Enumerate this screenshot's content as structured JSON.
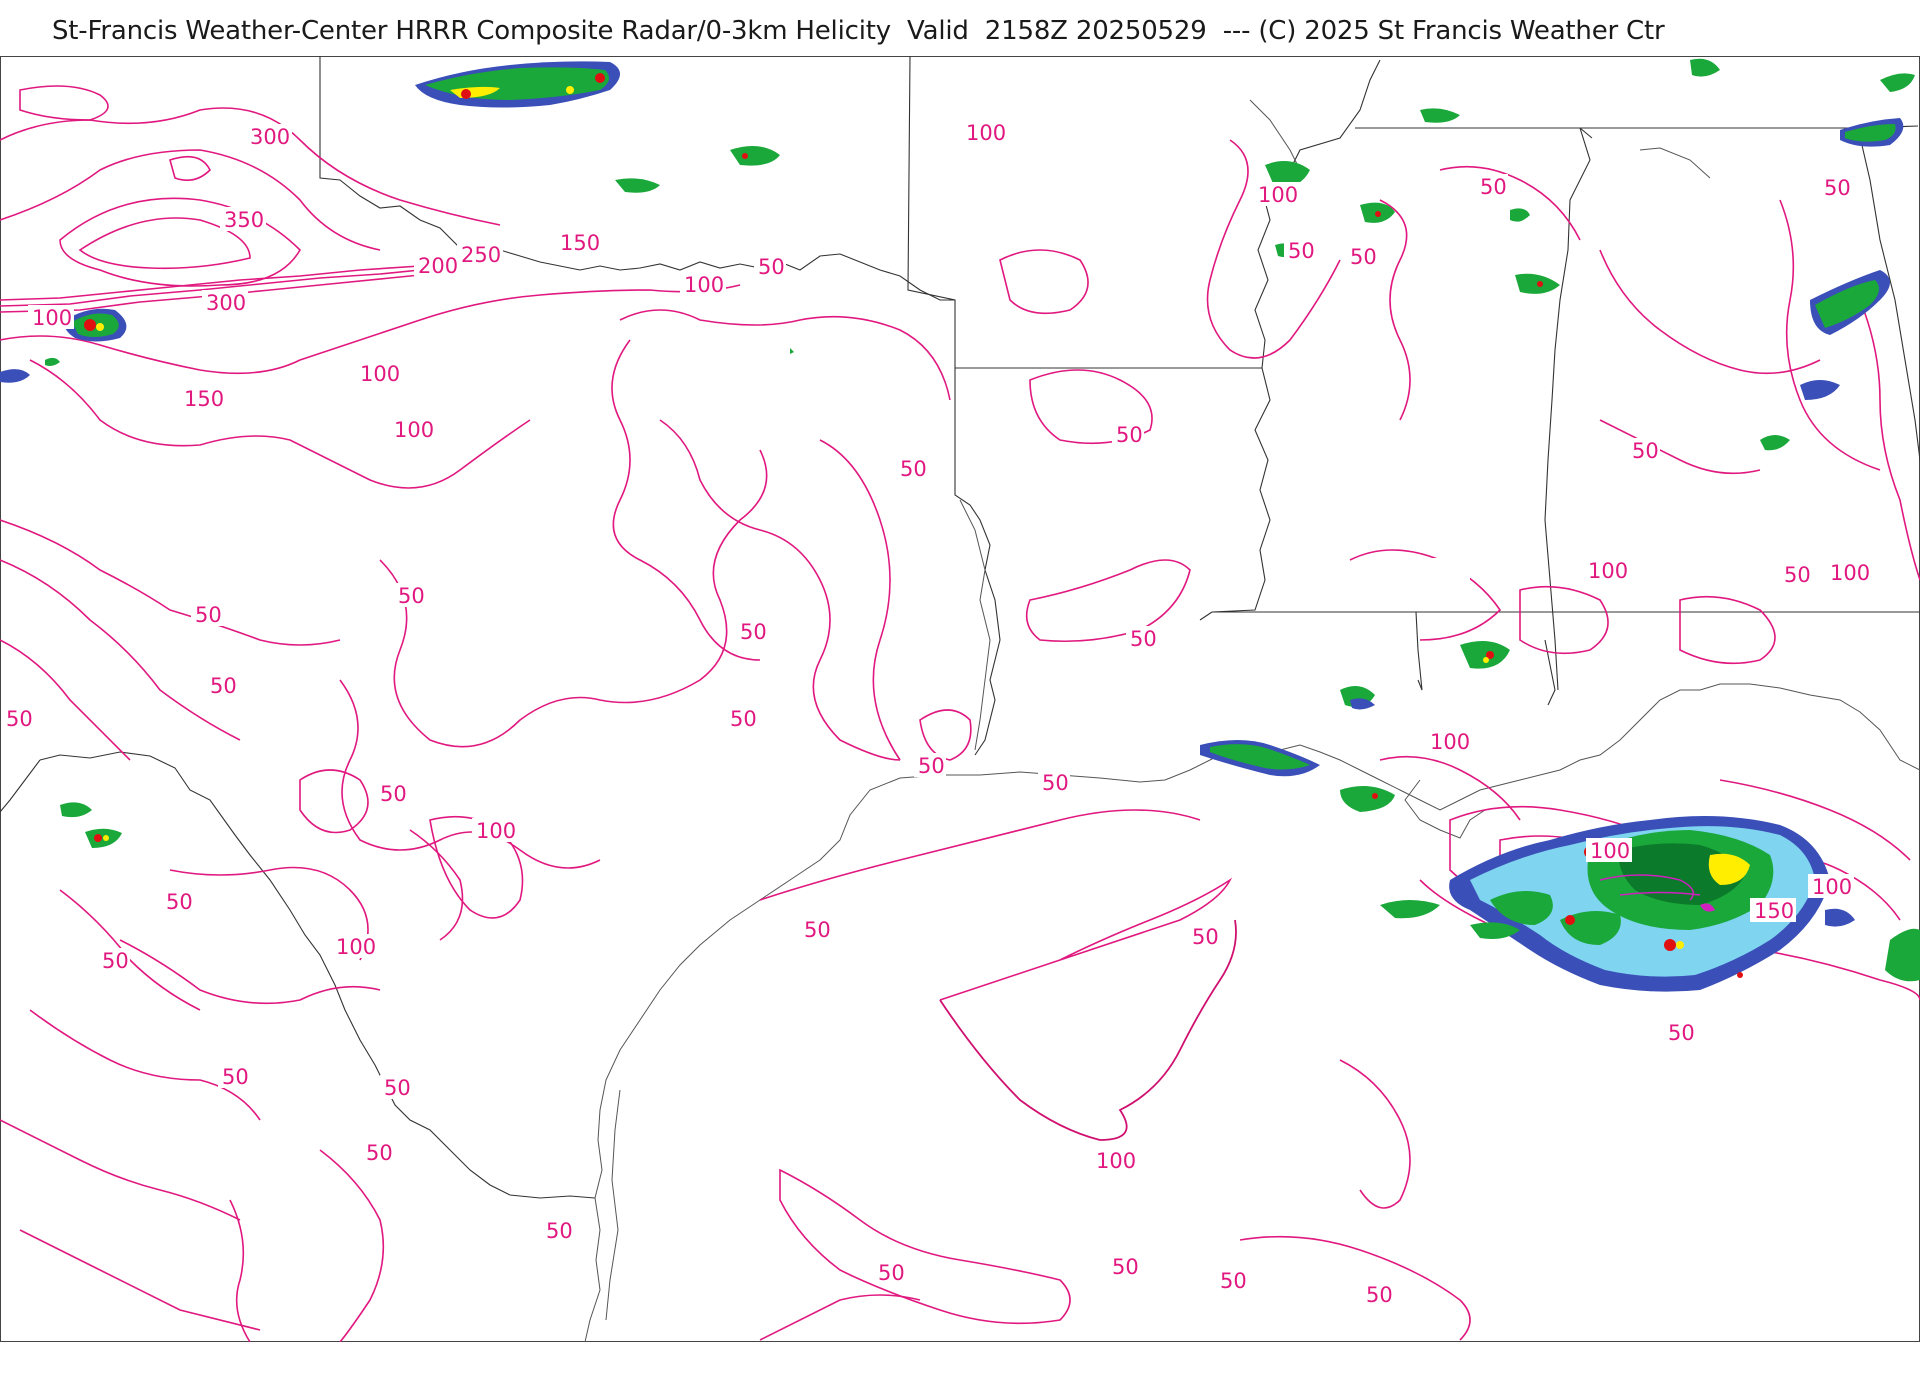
{
  "header": {
    "title": "St-Francis Weather-Center HRRR Composite Radar/0-3km Helicity  Valid  2158Z 20250529  --- (C) 2025 St Francis Weather Ctr"
  },
  "colors": {
    "helicity_contour": "#e0187f",
    "state_border": "#333333",
    "coastline": "#555555",
    "radar_light": "#7fd4f0",
    "radar_green": "#1aa83a",
    "radar_dark_green": "#0b7a2a",
    "radar_blue": "#3b4fb8",
    "radar_yellow": "#ffee00",
    "radar_red": "#e01010",
    "radar_magenta": "#d020c0"
  },
  "contour_labels": [
    {
      "text": "300"
    },
    {
      "text": "350"
    },
    {
      "text": "300"
    },
    {
      "text": "200"
    },
    {
      "text": "250"
    },
    {
      "text": "150"
    },
    {
      "text": "100"
    },
    {
      "text": "50"
    },
    {
      "text": "100"
    },
    {
      "text": "100"
    },
    {
      "text": "150"
    },
    {
      "text": "100"
    },
    {
      "text": "100"
    },
    {
      "text": "50"
    },
    {
      "text": "50"
    },
    {
      "text": "50"
    },
    {
      "text": "50"
    },
    {
      "text": "50"
    },
    {
      "text": "50"
    },
    {
      "text": "50"
    },
    {
      "text": "50"
    },
    {
      "text": "100"
    },
    {
      "text": "50"
    },
    {
      "text": "50"
    },
    {
      "text": "100"
    },
    {
      "text": "50"
    },
    {
      "text": "50"
    },
    {
      "text": "50"
    },
    {
      "text": "50"
    },
    {
      "text": "50"
    },
    {
      "text": "50"
    },
    {
      "text": "50"
    },
    {
      "text": "50"
    },
    {
      "text": "50"
    },
    {
      "text": "100"
    },
    {
      "text": "50"
    },
    {
      "text": "50"
    },
    {
      "text": "100"
    },
    {
      "text": "50"
    },
    {
      "text": "50"
    },
    {
      "text": "100"
    },
    {
      "text": "50"
    },
    {
      "text": "100"
    },
    {
      "text": "50"
    },
    {
      "text": "100"
    },
    {
      "text": "100"
    },
    {
      "text": "100"
    },
    {
      "text": "150"
    },
    {
      "text": "50"
    },
    {
      "text": "50"
    },
    {
      "text": "50"
    },
    {
      "text": "100"
    },
    {
      "text": "50"
    },
    {
      "text": "50"
    },
    {
      "text": "50"
    }
  ]
}
